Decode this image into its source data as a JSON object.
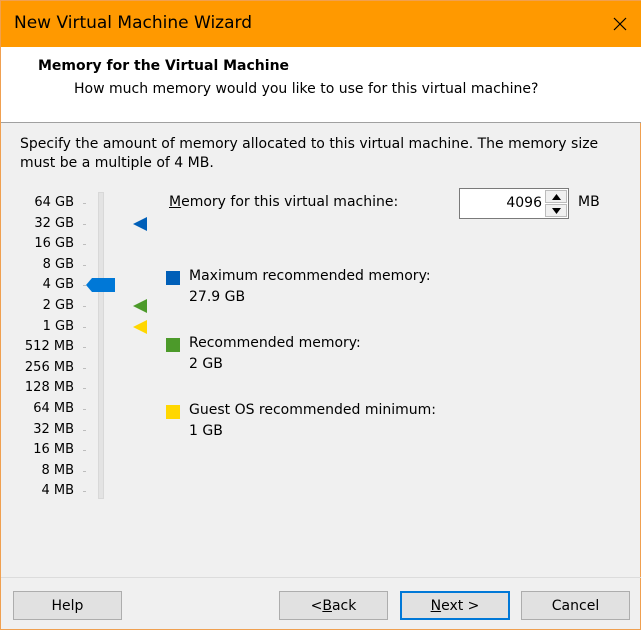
{
  "window": {
    "title": "New Virtual Machine Wizard",
    "accent_color": "#ff9900",
    "close_icon": "close-icon"
  },
  "header": {
    "title": "Memory for the Virtual Machine",
    "subtitle": "How much memory would you like to use for this virtual machine?"
  },
  "description": "Specify the amount of memory allocated to this virtual machine. The memory size must be a multiple of 4 MB.",
  "scale": {
    "ticks": [
      "64 GB",
      "32 GB",
      "16 GB",
      "8 GB",
      "4 GB",
      "2 GB",
      "1 GB",
      "512 MB",
      "256 MB",
      "128 MB",
      "64 MB",
      "32 MB",
      "16 MB",
      "8 MB",
      "4 MB"
    ],
    "selected": "4 GB",
    "markers": [
      {
        "name": "max-recommended-marker",
        "at": "32 GB",
        "color": "#005fb8"
      },
      {
        "name": "recommended-marker",
        "at": "2 GB",
        "color": "#4c9a2a"
      },
      {
        "name": "guest-min-marker",
        "at": "1 GB",
        "color": "#ffd700"
      }
    ]
  },
  "memory": {
    "label_pre": "",
    "label_accel": "M",
    "label_post": "emory for this virtual machine:",
    "value": "4096",
    "unit": "MB"
  },
  "legend": {
    "max": {
      "label": "Maximum recommended memory:",
      "value": "27.9 GB",
      "color": "#005fb8"
    },
    "recommended": {
      "label": "Recommended memory:",
      "value": "2 GB",
      "color": "#4c9a2a"
    },
    "guest_min": {
      "label": "Guest OS recommended minimum:",
      "value": "1 GB",
      "color": "#ffd700"
    }
  },
  "buttons": {
    "help": "Help",
    "back_pre": "< ",
    "back_accel": "B",
    "back_post": "ack",
    "next_accel": "N",
    "next_post": "ext >",
    "cancel": "Cancel"
  }
}
